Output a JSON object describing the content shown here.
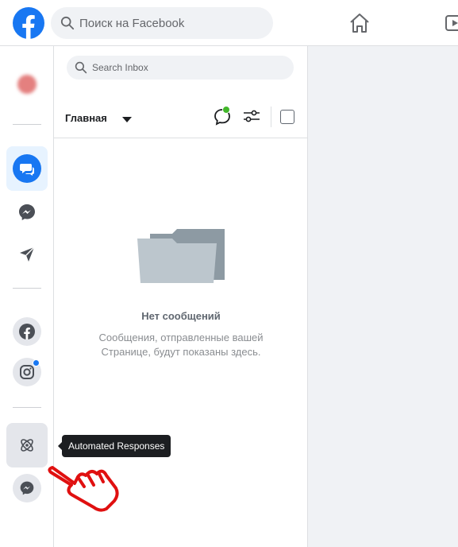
{
  "topbar": {
    "search_placeholder": "Поиск на Facebook",
    "brand_color": "#1877f2"
  },
  "rail": {
    "items": [
      {
        "name": "page-avatar"
      },
      {
        "name": "inbox",
        "icon": "chat-bubbles-icon",
        "active": true
      },
      {
        "name": "messenger",
        "icon": "messenger-icon"
      },
      {
        "name": "send",
        "icon": "send-icon"
      },
      {
        "name": "facebook",
        "icon": "facebook-icon"
      },
      {
        "name": "instagram",
        "icon": "instagram-icon",
        "badge": true
      },
      {
        "name": "automated-responses",
        "icon": "atom-icon",
        "hover": true
      },
      {
        "name": "messenger-2",
        "icon": "messenger-icon"
      }
    ]
  },
  "inbox": {
    "search_placeholder": "Search Inbox",
    "filter_label": "Главная",
    "empty_title": "Нет сообщений",
    "empty_desc": "Сообщения, отправленные вашей Странице, будут показаны здесь."
  },
  "tooltip": {
    "text": "Automated Responses"
  },
  "colors": {
    "accent": "#1877f2",
    "online": "#42b72a",
    "pointer_hand": "#e01010"
  }
}
